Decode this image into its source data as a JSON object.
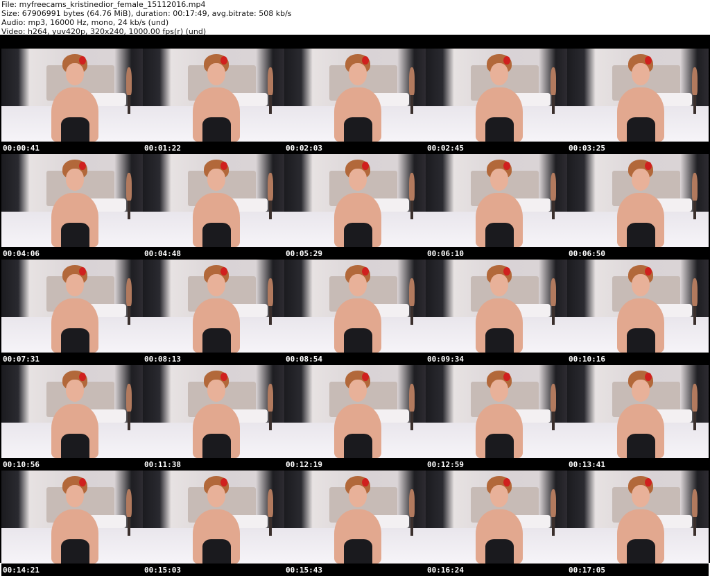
{
  "header": {
    "file_line": "File: myfreecams_kristinedior_female_15112016.mp4",
    "size_line": "Size: 67906991 bytes (64.76 MiB), duration: 00:17:49, avg.bitrate: 508 kb/s",
    "audio_line": "Audio: mp3, 16000 Hz, mono, 24 kb/s (und)",
    "video_line": "Video: h264, yuv420p, 320x240, 1000.00 fps(r) (und)"
  },
  "thumbnails": [
    {
      "timestamp": "00:00:41"
    },
    {
      "timestamp": "00:01:22"
    },
    {
      "timestamp": "00:02:03"
    },
    {
      "timestamp": "00:02:45"
    },
    {
      "timestamp": "00:03:25"
    },
    {
      "timestamp": "00:04:06"
    },
    {
      "timestamp": "00:04:48"
    },
    {
      "timestamp": "00:05:29"
    },
    {
      "timestamp": "00:06:10"
    },
    {
      "timestamp": "00:06:50"
    },
    {
      "timestamp": "00:07:31"
    },
    {
      "timestamp": "00:08:13"
    },
    {
      "timestamp": "00:08:54"
    },
    {
      "timestamp": "00:09:34"
    },
    {
      "timestamp": "00:10:16"
    },
    {
      "timestamp": "00:10:56"
    },
    {
      "timestamp": "00:11:38"
    },
    {
      "timestamp": "00:12:19"
    },
    {
      "timestamp": "00:12:59"
    },
    {
      "timestamp": "00:13:41"
    },
    {
      "timestamp": "00:14:21"
    },
    {
      "timestamp": "00:15:03"
    },
    {
      "timestamp": "00:15:43"
    },
    {
      "timestamp": "00:16:24"
    },
    {
      "timestamp": "00:17:05"
    }
  ]
}
